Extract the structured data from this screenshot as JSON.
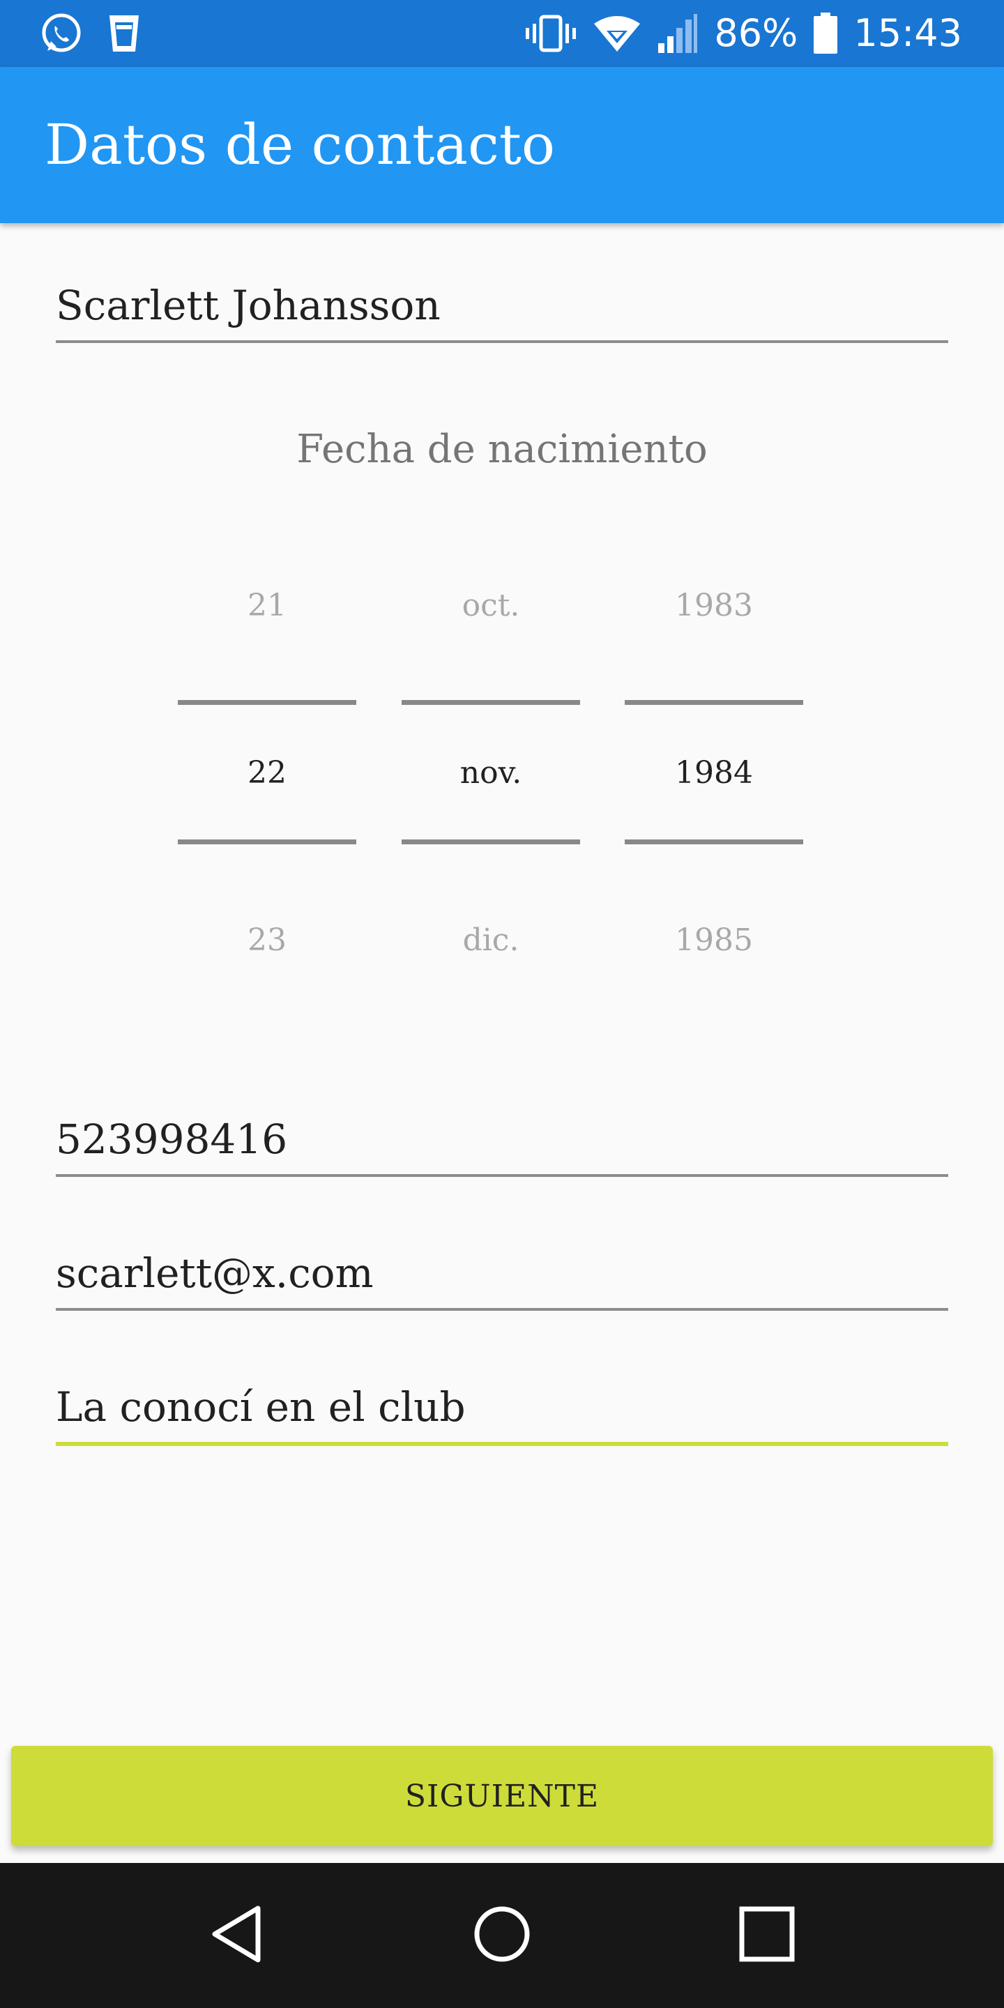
{
  "status_bar": {
    "left_icons": [
      "whatsapp-icon",
      "glass-icon"
    ],
    "right_icons": [
      "vibrate-icon",
      "wifi-icon",
      "signal-icon",
      "battery-icon"
    ],
    "battery": "86%",
    "time": "15:43"
  },
  "app_bar": {
    "title": "Datos de contacto"
  },
  "form": {
    "name": "Scarlett Johansson",
    "birth_date_label": "Fecha de nacimiento",
    "date_picker": {
      "day": {
        "prev": "21",
        "selected": "22",
        "next": "23"
      },
      "month": {
        "prev": "oct.",
        "selected": "nov.",
        "next": "dic."
      },
      "year": {
        "prev": "1983",
        "selected": "1984",
        "next": "1985"
      }
    },
    "phone": "523998416",
    "email": "scarlett@x.com",
    "notes": "La conocí en el club"
  },
  "next_button": {
    "label": "SIGUIENTE"
  },
  "nav_bar": {
    "icons": [
      "back-icon",
      "home-icon",
      "recents-icon"
    ]
  },
  "colors": {
    "status_bar": "#1976d2",
    "app_bar": "#2196f3",
    "accent": "#cddc39",
    "background": "#fafafa",
    "nav_bar": "#171717"
  }
}
